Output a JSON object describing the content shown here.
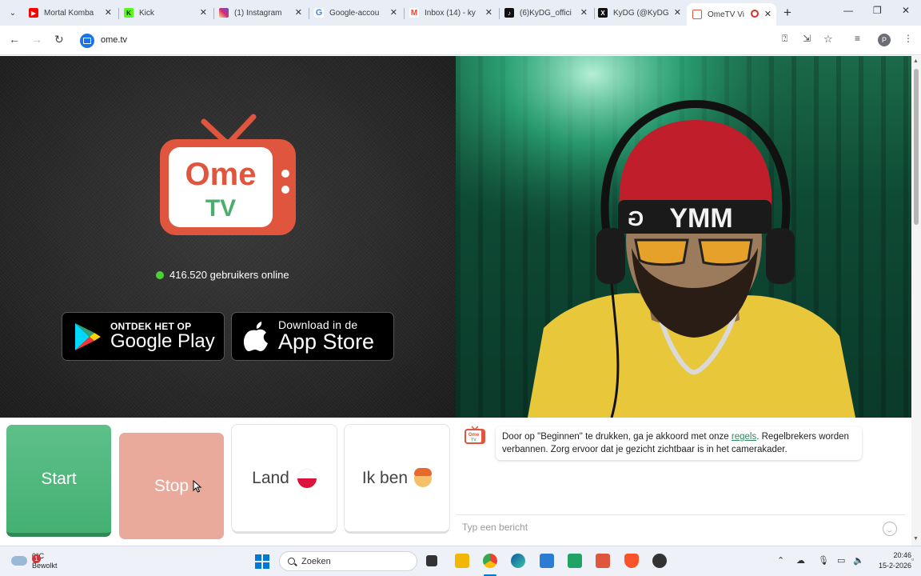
{
  "browser": {
    "tabs": [
      {
        "title": "Mortal Komba",
        "color": "#ff0000",
        "glyph": "▶"
      },
      {
        "title": "Kick",
        "color": "#53fc18",
        "glyph": "K"
      },
      {
        "title": "(1) Instagram",
        "color": "#d62976",
        "glyph": "◎"
      },
      {
        "title": "Google-accou",
        "color": "#4285f4",
        "glyph": "G"
      },
      {
        "title": "Inbox (14) - ky",
        "color": "#ea4335",
        "glyph": "M"
      },
      {
        "title": "(6)KyDG_offici",
        "color": "#111111",
        "glyph": "♪"
      },
      {
        "title": "KyDG (@KyDG",
        "color": "#111111",
        "glyph": "X"
      },
      {
        "title": "OmeTV Vi",
        "color": "#e0553d",
        "glyph": "▣"
      }
    ],
    "url": "ome.tv",
    "profile_initial": "P"
  },
  "logo": {
    "line1": "Ome",
    "line2": "TV"
  },
  "online_text": "416.520 gebruikers online",
  "store": {
    "google_small": "ONTDEK HET OP",
    "google_big": "Google Play",
    "apple_small": "Download in de",
    "apple_big": "App Store"
  },
  "controls": {
    "start": "Start",
    "stop": "Stop",
    "land": "Land",
    "ik_ben": "Ik ben"
  },
  "chat": {
    "message_before": "Door op \"Beginnen\" te drukken, ga je akkoord met onze ",
    "message_link": "regels",
    "message_after": ". Regelbrekers worden verbannen. Zorg ervoor dat je gezicht zichtbaar is in het camerakader.",
    "input_placeholder": "Typ een bericht",
    "avatar_line1": "Ome",
    "avatar_line2": "TV"
  },
  "video": {
    "headband_text": "YMM",
    "headband_partial": "G"
  },
  "taskbar": {
    "weather_temp": "0°C",
    "weather_desc": "Bewolkt",
    "weather_badge": "1",
    "search_label": "Zoeken",
    "time": "20:46",
    "date": "15-2-2026"
  },
  "colors": {
    "accent_green": "#44b072",
    "stop_salmon": "#e9a99b",
    "ome_orange": "#e0553d",
    "online_dot": "#4cd137"
  }
}
